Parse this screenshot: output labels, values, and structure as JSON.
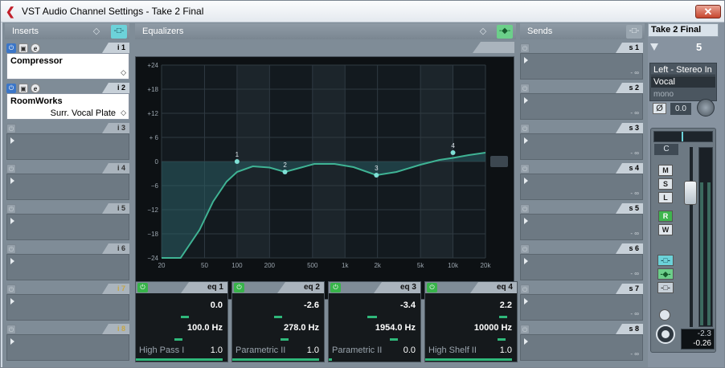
{
  "window": {
    "title": "VST Audio Channel Settings - Take 2 Final",
    "close_glyph": "✕"
  },
  "inserts": {
    "header": "Inserts",
    "slots": [
      {
        "tab": "i 1",
        "active": true,
        "name": "Compressor",
        "program": ""
      },
      {
        "tab": "i 2",
        "active": true,
        "name": "RoomWorks",
        "program": "Surr. Vocal Plate"
      },
      {
        "tab": "i 3",
        "active": false
      },
      {
        "tab": "i 4",
        "active": false
      },
      {
        "tab": "i 5",
        "active": false
      },
      {
        "tab": "i 6",
        "active": false
      },
      {
        "tab": "i 7",
        "active": false,
        "dim": true
      },
      {
        "tab": "i 8",
        "active": false,
        "dim": true
      }
    ]
  },
  "equalizers": {
    "header": "Equalizers",
    "y_ticks": [
      "+24",
      "+18",
      "+12",
      "+ 6",
      "0",
      "−6",
      "−12",
      "−18",
      "−24"
    ],
    "x_ticks": [
      "20",
      "50",
      "100",
      "200",
      "500",
      "1k",
      "2k",
      "5k",
      "10k",
      "20k"
    ],
    "points": [
      {
        "label": "1",
        "freq": 100,
        "gain": 0.0
      },
      {
        "label": "2",
        "freq": 278,
        "gain": -2.6
      },
      {
        "label": "3",
        "freq": 1954,
        "gain": -3.4
      },
      {
        "label": "4",
        "freq": 10000,
        "gain": 2.2
      }
    ],
    "bands": [
      {
        "label": "eq 1",
        "gain": "0.0",
        "freq": "100.0 Hz",
        "type": "High Pass I",
        "q": "1.0"
      },
      {
        "label": "eq 2",
        "gain": "-2.6",
        "freq": "278.0 Hz",
        "type": "Parametric II",
        "q": "1.0"
      },
      {
        "label": "eq 3",
        "gain": "-3.4",
        "freq": "1954.0 Hz",
        "type": "Parametric II",
        "q": "0.0"
      },
      {
        "label": "eq 4",
        "gain": "2.2",
        "freq": "10000 Hz",
        "type": "High Shelf II",
        "q": "1.0"
      }
    ]
  },
  "sends": {
    "header": "Sends",
    "slots": [
      "s 1",
      "s 2",
      "s 3",
      "s 4",
      "s 5",
      "s 6",
      "s 7",
      "s 8"
    ],
    "value": "- ∞"
  },
  "strip": {
    "name": "Take 2 Final",
    "number": "5",
    "input": "Left - Stereo In",
    "output": "Vocal",
    "mode": "mono",
    "phase_glyph": "Ø",
    "gain": "0.0",
    "pan": "C",
    "buttons": {
      "mute": "M",
      "solo": "S",
      "listen": "L",
      "read": "R",
      "write": "W"
    },
    "peak": "-2.3",
    "level": "-0.26"
  },
  "colors": {
    "accent_cyan": "#6cd2d9",
    "accent_green": "#6ccf8a",
    "curve": "#3fb394"
  }
}
